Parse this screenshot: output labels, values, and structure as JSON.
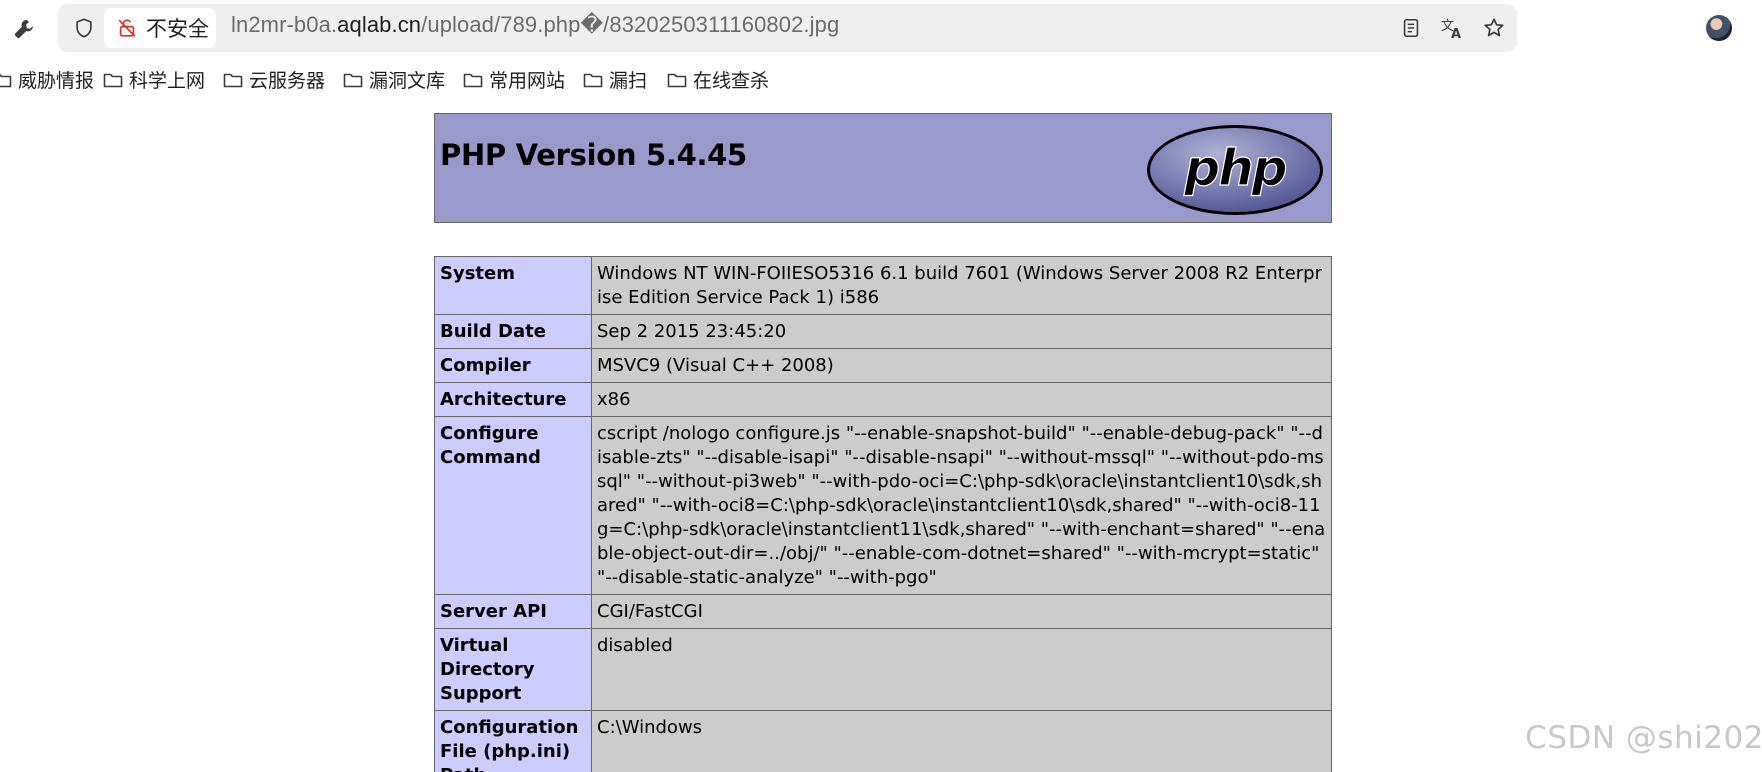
{
  "browser": {
    "security_label": "不安全",
    "url_prefix": "ln2mr-b0a.",
    "url_host": "aqlab.cn",
    "url_path": "/upload/789.php�/8320250311160802.jpg"
  },
  "bookmarks": [
    {
      "label": "威胁情报"
    },
    {
      "label": "科学上网"
    },
    {
      "label": "云服务器"
    },
    {
      "label": "漏洞文库"
    },
    {
      "label": "常用网站"
    },
    {
      "label": "漏扫"
    },
    {
      "label": "在线查杀"
    }
  ],
  "php": {
    "title": "PHP Version 5.4.45",
    "logo_text": "php",
    "rows": [
      {
        "key": "System",
        "value": "Windows NT WIN-FOIIESO5316 6.1 build 7601 (Windows Server 2008 R2 Enterprise Edition Service Pack 1) i586"
      },
      {
        "key": "Build Date",
        "value": "Sep 2 2015 23:45:20"
      },
      {
        "key": "Compiler",
        "value": "MSVC9 (Visual C++ 2008)"
      },
      {
        "key": "Architecture",
        "value": "x86"
      },
      {
        "key": "Configure Command",
        "value": "cscript /nologo configure.js \"--enable-snapshot-build\" \"--enable-debug-pack\" \"--disable-zts\" \"--disable-isapi\" \"--disable-nsapi\" \"--without-mssql\" \"--without-pdo-mssql\" \"--without-pi3web\" \"--with-pdo-oci=C:\\php-sdk\\oracle\\instantclient10\\sdk,shared\" \"--with-oci8=C:\\php-sdk\\oracle\\instantclient10\\sdk,shared\" \"--with-oci8-11g=C:\\php-sdk\\oracle\\instantclient11\\sdk,shared\" \"--with-enchant=shared\" \"--enable-object-out-dir=../obj/\" \"--enable-com-dotnet=shared\" \"--with-mcrypt=static\" \"--disable-static-analyze\" \"--with-pgo\""
      },
      {
        "key": "Server API",
        "value": "CGI/FastCGI"
      },
      {
        "key": "Virtual Directory Support",
        "value": "disabled"
      },
      {
        "key": "Configuration File (php.ini) Path",
        "value": "C:\\Windows"
      }
    ]
  },
  "watermark": "CSDN @shi202",
  "colors": {
    "header_bg": "#9999cc",
    "key_cell_bg": "#ccccff",
    "value_cell_bg": "#cccccc"
  }
}
